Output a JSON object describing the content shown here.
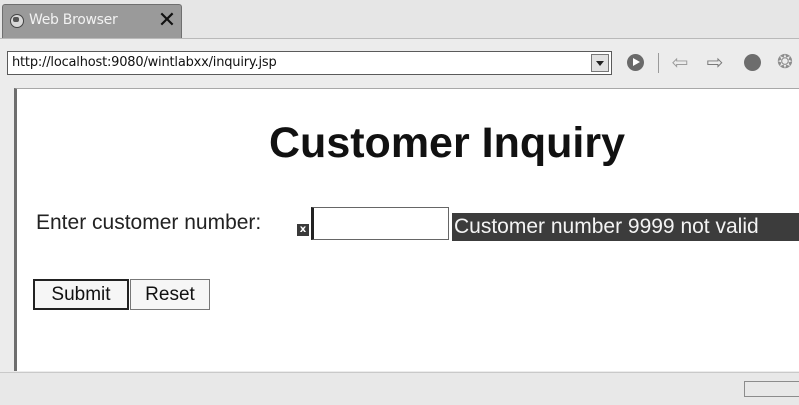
{
  "window": {
    "tab_title": "Web Browser",
    "close_glyph": "✕"
  },
  "toolbar": {
    "url": "http://localhost:9080/wintlabxx/inquiry.jsp",
    "icons": [
      "globe-icon",
      "dropdown-icon",
      "go-icon",
      "back-icon",
      "forward-icon",
      "stop-icon",
      "refresh-icon"
    ],
    "back_glyph": "⇦",
    "forward_glyph": "⇨",
    "refresh_glyph": "❂"
  },
  "page": {
    "heading": "Customer Inquiry",
    "prompt_label": "Enter customer number:",
    "error_marker": "x",
    "customer_input_value": "",
    "error_message": "Customer number 9999 not valid",
    "submit_label": "Submit",
    "reset_label": "Reset"
  },
  "colors": {
    "error_background": "#3c3c3c",
    "tab_background": "#9a9a9a"
  }
}
